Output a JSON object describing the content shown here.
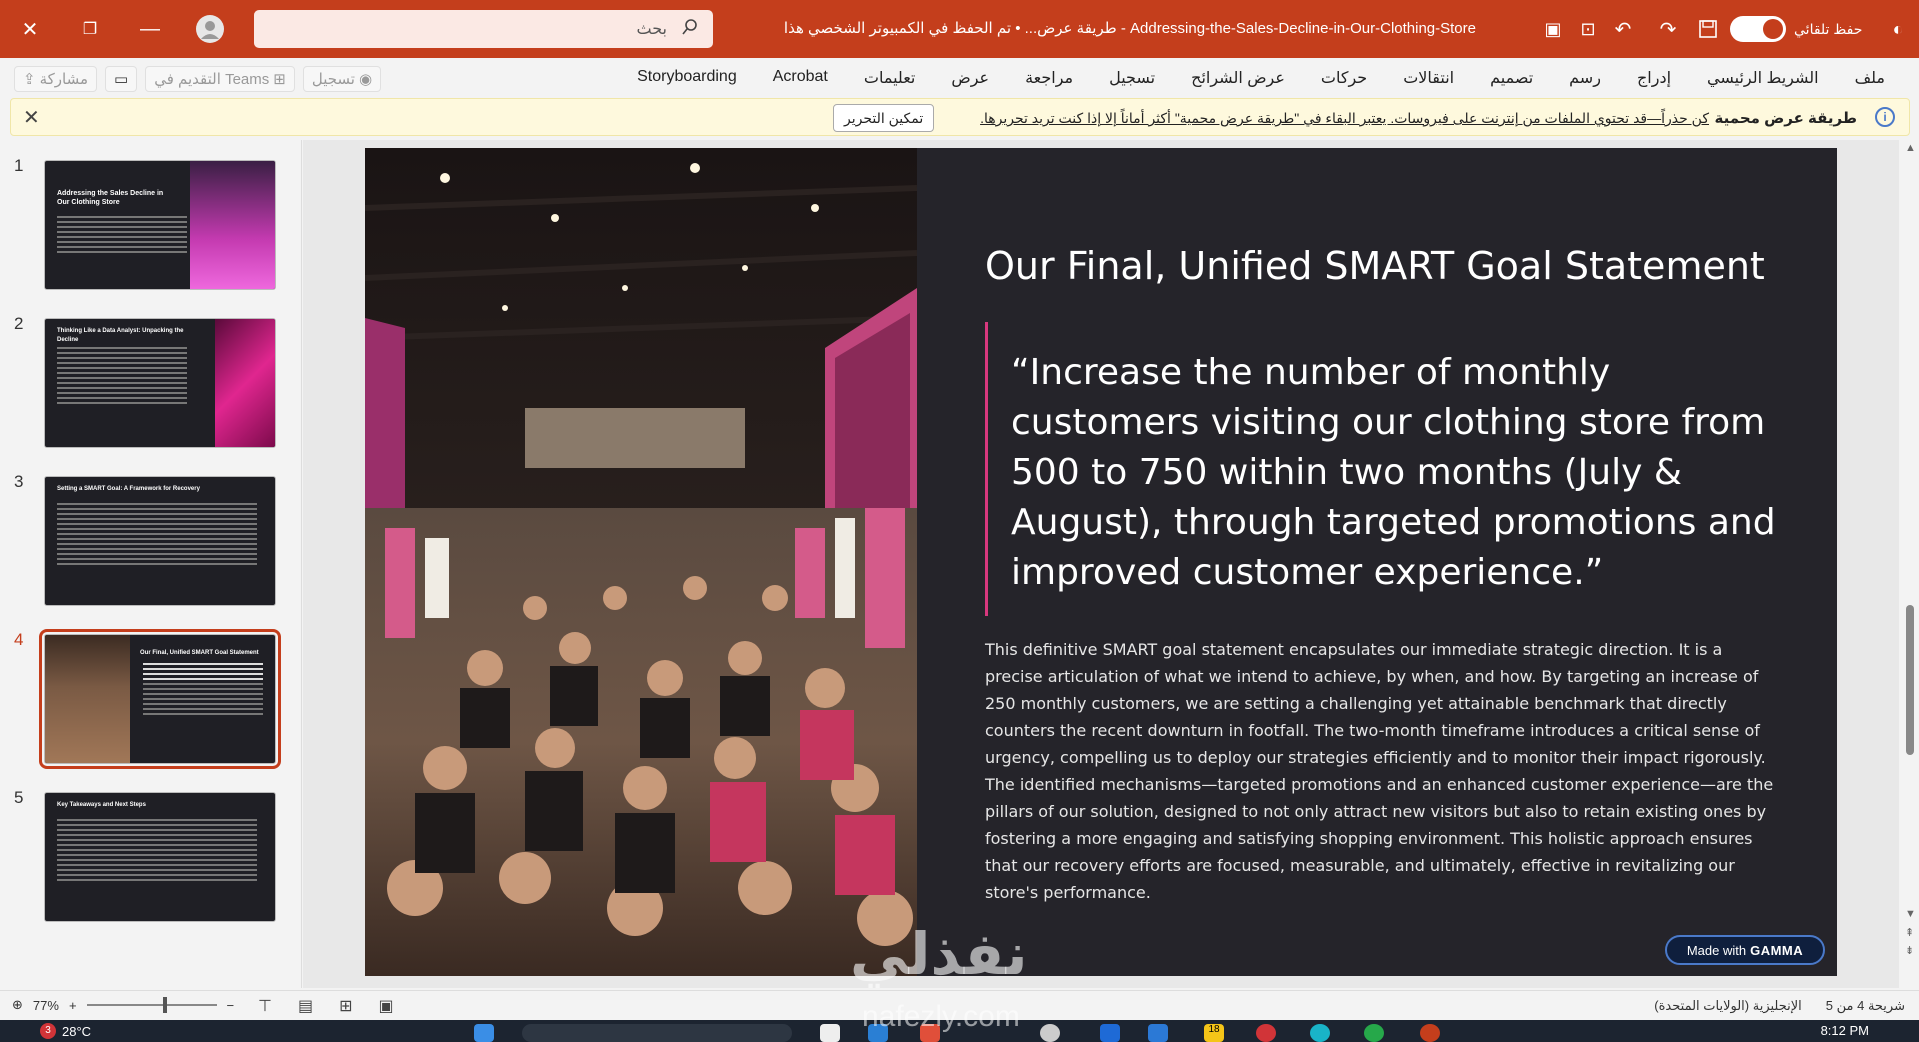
{
  "titlebar": {
    "title": "Addressing-the-Sales-Decline-in-Our-Clothing-Store  -  طريقة عرض...  •  تم الحفظ في الكمبيوتر الشخصي هذا",
    "search_placeholder": "بحث",
    "autosave_label": "حفظ تلقائي"
  },
  "ribbon": {
    "tabs": [
      "ملف",
      "الشريط الرئيسي",
      "إدراج",
      "رسم",
      "تصميم",
      "انتقالات",
      "حركات",
      "عرض الشرائح",
      "تسجيل",
      "مراجعة",
      "عرض",
      "تعليمات",
      "Acrobat",
      "Storyboarding"
    ],
    "share_label": "مشاركة",
    "teams_label": "التقديم في Teams",
    "record_label": "تسجيل"
  },
  "protected_view": {
    "title": "طريقة عرض محمية",
    "message": "كن حذراً—قد تحتوي الملفات من إنترنت على فيروسات. يعتبر البقاء في \"طريقة عرض محمية\" أكثر أماناً إلا إذا كنت تريد تحريرها.",
    "enable_button": "تمكين التحرير"
  },
  "thumbnails": [
    {
      "num": "1",
      "title": "Addressing the Sales Decline in Our Clothing Store",
      "accent": "#c43ab0"
    },
    {
      "num": "2",
      "title": "Thinking Like a Data Analyst: Unpacking the Decline",
      "accent": "#d0228c"
    },
    {
      "num": "3",
      "title": "Setting a SMART Goal: A Framework for Recovery",
      "accent": ""
    },
    {
      "num": "4",
      "title": "Our Final, Unified SMART Goal Statement",
      "accent": "#c43e1c"
    },
    {
      "num": "5",
      "title": "Key Takeaways and Next Steps",
      "accent": ""
    }
  ],
  "slide": {
    "title": "Our Final, Unified SMART Goal Statement",
    "quote": "“Increase the number of monthly customers visiting our clothing store from 500 to 750 within two months (July & August), through targeted promotions and improved customer experience.”",
    "body": "This definitive SMART goal statement encapsulates our immediate strategic direction. It is a precise articulation of what we intend to achieve, by when, and how. By targeting an increase of 250 monthly customers, we are setting a challenging yet attainable benchmark that directly counters the recent downturn in footfall. The two-month timeframe introduces a critical sense of urgency, compelling us to deploy our strategies efficiently and to monitor their impact rigorously. The identified mechanisms—targeted promotions and an enhanced customer experience—are the pillars of our solution, designed to not only attract new visitors but also to retain existing ones by fostering a more engaging and satisfying shopping environment. This holistic approach ensures that our recovery efforts are focused, measurable, and ultimately, effective in revitalizing our store's performance.",
    "badge_prefix": "Made with",
    "badge_brand": "GAMMA",
    "accent_color": "#d8387e"
  },
  "statusbar": {
    "slide_counter": "شريحة 4 من 5",
    "language": "الإنجليزية (الولايات المتحدة)",
    "zoom": "77%"
  },
  "taskbar": {
    "temperature": "28°C",
    "notification_count": "3",
    "time": "8:12 PM",
    "app_badge": "18"
  },
  "watermark": {
    "arabic": "نفذلي",
    "latin": "nafezly.com"
  }
}
